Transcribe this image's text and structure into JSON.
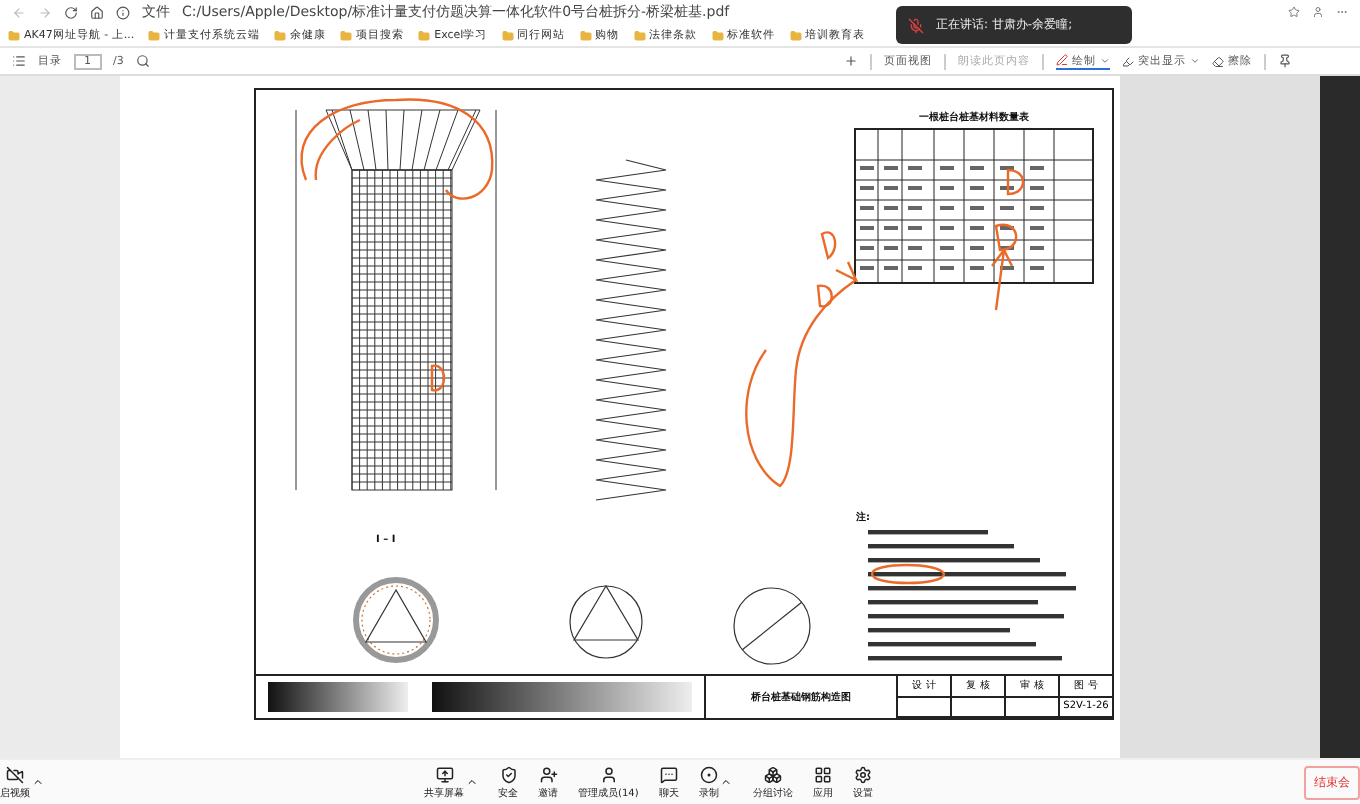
{
  "browser": {
    "address_label": "文件",
    "address": "C:/Users/Apple/Desktop/标准计量支付仿题决算一体化软件0号台桩拆分-桥梁桩基.pdf",
    "bookmarks": [
      "AK47网址导航 - 上...",
      "计量支付系统云端",
      "余健康",
      "项目搜索",
      "Excel学习",
      "同行网站",
      "购物",
      "法律条款",
      "标准软件",
      "培训教育表"
    ]
  },
  "pdf_toolbar": {
    "contents": "目录",
    "page": "1",
    "page_total": "/3",
    "page_view": "页面视图",
    "read_aloud": "朗读此页内容",
    "draw": "绘制",
    "highlight": "突出显示",
    "erase": "擦除"
  },
  "notification": {
    "text": "正在讲话: 甘肃办-余爱瞳;"
  },
  "drawing": {
    "section_label": "I – I",
    "table_title": "一根桩台桩基材料数量表",
    "notes_heading": "注:",
    "title_block": {
      "drawing_title": "桥台桩基础钢筋构造图",
      "labels": [
        "设 计",
        "复 核",
        "审 核",
        "图 号"
      ],
      "drawing_number": "S2V-1-26"
    }
  },
  "meeting_toolbar": {
    "start_item": {
      "label": "启视频",
      "caret": true
    },
    "items": [
      {
        "label": "共享屏幕",
        "caret": true
      },
      {
        "label": "安全",
        "caret": false
      },
      {
        "label": "邀请",
        "caret": false
      },
      {
        "label": "管理成员(14)",
        "caret": false
      },
      {
        "label": "聊天",
        "caret": false
      },
      {
        "label": "录制",
        "caret": true
      },
      {
        "label": "分组讨论",
        "caret": false
      },
      {
        "label": "应用",
        "caret": false
      },
      {
        "label": "设置",
        "caret": false
      }
    ],
    "end_button": "结束会"
  }
}
